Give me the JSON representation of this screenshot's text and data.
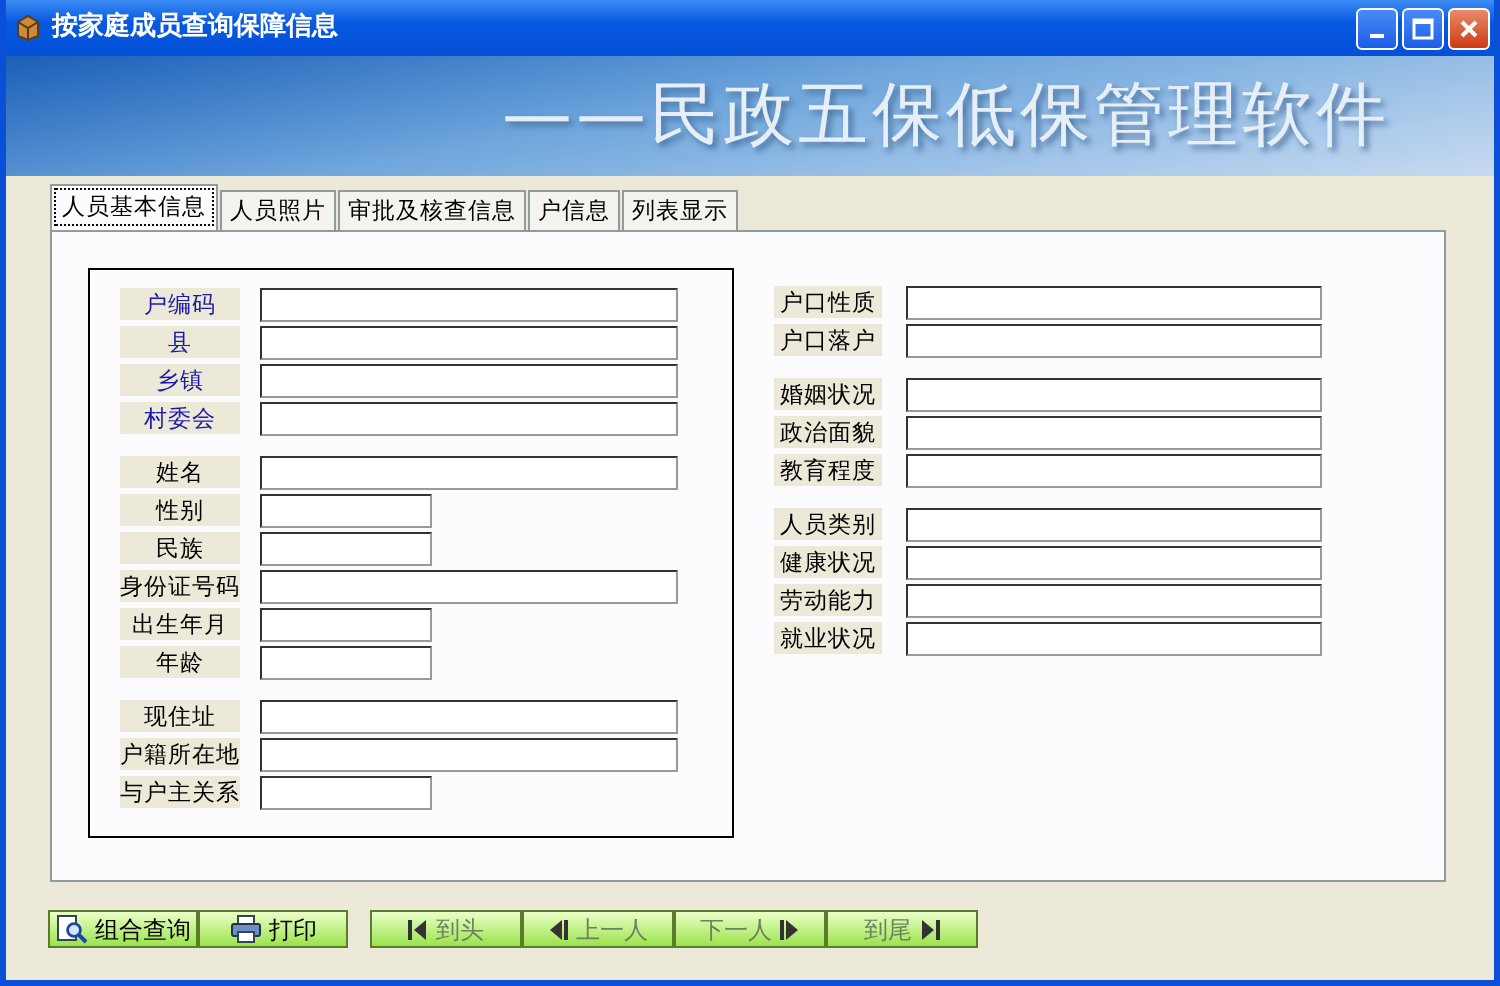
{
  "window": {
    "title": "按家庭成员查询保障信息"
  },
  "banner": {
    "text": "——民政五保低保管理软件"
  },
  "tabs": [
    {
      "label": "人员基本信息",
      "selected": true
    },
    {
      "label": "人员照片",
      "selected": false
    },
    {
      "label": "审批及核查信息",
      "selected": false
    },
    {
      "label": "户信息",
      "selected": false
    },
    {
      "label": "列表显示",
      "selected": false
    }
  ],
  "left_groups": [
    [
      {
        "label": "户编码",
        "kind": "link",
        "short": false
      },
      {
        "label": "县",
        "kind": "link",
        "short": false
      },
      {
        "label": "乡镇",
        "kind": "link",
        "short": false
      },
      {
        "label": "村委会",
        "kind": "link",
        "short": false
      }
    ],
    [
      {
        "label": "姓名",
        "kind": "plain",
        "short": false
      },
      {
        "label": "性别",
        "kind": "plain",
        "short": true
      },
      {
        "label": "民族",
        "kind": "plain",
        "short": true
      },
      {
        "label": "身份证号码",
        "kind": "plain",
        "short": false
      },
      {
        "label": "出生年月",
        "kind": "plain",
        "short": true
      },
      {
        "label": "年龄",
        "kind": "plain",
        "short": true
      }
    ],
    [
      {
        "label": "现住址",
        "kind": "plain",
        "short": false
      },
      {
        "label": "户籍所在地",
        "kind": "plain",
        "short": false
      },
      {
        "label": "与户主关系",
        "kind": "plain",
        "short": true
      }
    ]
  ],
  "right_groups": [
    [
      {
        "label": "户口性质",
        "kind": "plain",
        "short": false
      },
      {
        "label": "户口落户",
        "kind": "plain",
        "short": false
      }
    ],
    [
      {
        "label": "婚姻状况",
        "kind": "plain",
        "short": false
      },
      {
        "label": "政治面貌",
        "kind": "plain",
        "short": false
      },
      {
        "label": "教育程度",
        "kind": "plain",
        "short": false
      }
    ],
    [
      {
        "label": "人员类别",
        "kind": "plain",
        "short": false
      },
      {
        "label": "健康状况",
        "kind": "plain",
        "short": false
      },
      {
        "label": "劳动能力",
        "kind": "plain",
        "short": false
      },
      {
        "label": "就业状况",
        "kind": "plain",
        "short": false
      }
    ]
  ],
  "action_buttons": [
    {
      "label": "组合查询",
      "kind": "query"
    },
    {
      "label": "打印",
      "kind": "print"
    }
  ],
  "nav_buttons": [
    {
      "label": "到头",
      "kind": "first",
      "disabled": true
    },
    {
      "label": "上一人",
      "kind": "prev",
      "disabled": true
    },
    {
      "label": "下一人",
      "kind": "next",
      "disabled": true
    },
    {
      "label": "到尾",
      "kind": "last",
      "disabled": true
    }
  ]
}
